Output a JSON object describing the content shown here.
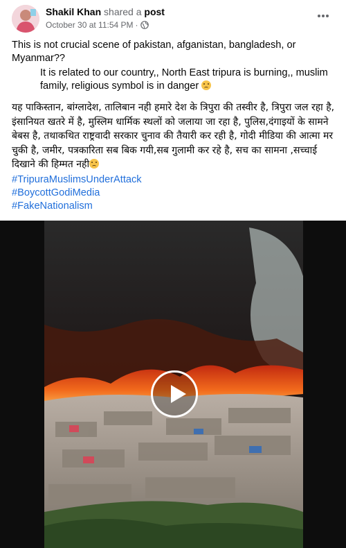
{
  "post": {
    "author": "Shakil Khan",
    "action": "shared a",
    "object": "post",
    "timestamp": "October 30 at 11:54 PM",
    "separator": "·",
    "privacy_icon": "globe-icon",
    "paragraph1": "This is not crucial scene of pakistan, afganistan, bangladesh, or Myanmar??",
    "paragraph2": "It is related to our country,, North East tripura is burning,, muslim family, religious symbol is in danger",
    "paragraph3": "यह पाकिस्तान, बांग्लादेश, तालिबान नही हमारे देश के त्रिपुरा की तस्वीर है, त्रिपुरा जल रहा है, इंसानियत खतरे में है, मुस्लिम धार्मिक स्थलों को जलाया जा रहा है, पुलिस,दंगाइयों के सामने बेबस है, तथाकथित राष्ट्रवादी सरकार चुनाव की तैयारी कर रही है, गोदी मीडिया की आत्मा मर चुकी है, जमीर, पत्रकारिता सब बिक गयी,सब गुलामी कर रहे है, सच का सामना ,सच्चाई दिखाने की हिम्मत नही",
    "hashtags": [
      "#TripuraMuslimsUnderAttack",
      "#BoycottGodiMedia",
      "#FakeNationalism"
    ]
  },
  "icons": {
    "more": "more-options-icon",
    "play": "play-icon",
    "emoji": "sad-face-emoji"
  }
}
